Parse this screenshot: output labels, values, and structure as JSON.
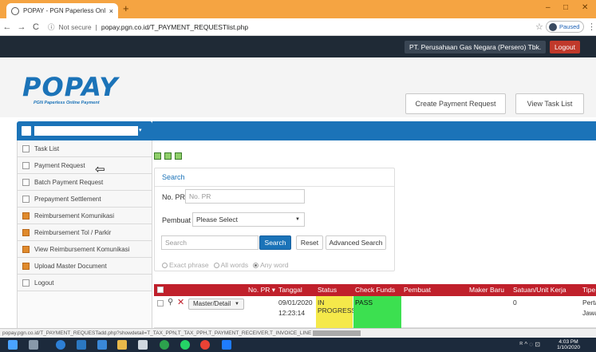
{
  "browser": {
    "tab_title": "POPAY - PGN Paperless Online P...",
    "tab_close": "×",
    "new_tab": "+",
    "win_min": "–",
    "win_max": "□",
    "win_close": "✕",
    "back": "←",
    "forward": "→",
    "reload": "C",
    "security_label": "Not secure",
    "url": "popay.pgn.co.id/T_PAYMENT_REQUESTlist.php",
    "star": "☆",
    "profile_label": "Paused",
    "menu": "⋮"
  },
  "topbar": {
    "company": "PT. Perusahaan Gas Negara (Persero) Tbk.",
    "logout": "Logout"
  },
  "header": {
    "logo_word": "POPAY",
    "logo_sub": "PGN Paperless Online Payment",
    "create_payment_request": "Create Payment Request",
    "view_task_list": "View Task List"
  },
  "sidebar": {
    "caret": "▾",
    "items": [
      {
        "label": "Task List",
        "icon": "doc"
      },
      {
        "label": "Payment Request",
        "icon": "doc"
      },
      {
        "label": "Batch Payment Request",
        "icon": "doc"
      },
      {
        "label": "Prepayment Settlement",
        "icon": "doc"
      },
      {
        "label": "Reimbursement Komunikasi",
        "icon": "org"
      },
      {
        "label": "Reimbursement Tol / Parkir",
        "icon": "org"
      },
      {
        "label": "View Reimbursement Komunikasi",
        "icon": "org"
      },
      {
        "label": "Upload Master Document",
        "icon": "org"
      },
      {
        "label": "Logout",
        "icon": "doc"
      }
    ],
    "pointer": "⇦"
  },
  "search": {
    "title": "Search",
    "no_pr_label": "No. PR",
    "no_pr_placeholder": "No. PR",
    "pembuat_label": "Pembuat",
    "pembuat_value": "Please Select",
    "keyword_placeholder": "Search",
    "search_button": "Search",
    "reset_button": "Reset",
    "advanced_button": "Advanced Search",
    "radios": [
      "Exact phrase",
      "All words",
      "Any word"
    ],
    "radio_selected": "Any word"
  },
  "table": {
    "headers": [
      "No. PR ▾",
      "Tanggal",
      "Status",
      "Check Funds",
      "Pembuat",
      "Maker Baru",
      "Satuan/Unit Kerja",
      "Tipe P"
    ],
    "row": {
      "action": "Master/Detail",
      "tanggal_date": "09/01/2020",
      "tanggal_time": "12:23:14",
      "status_line1": "IN",
      "status_line2": "PROGRESS",
      "check_funds": "PASS",
      "satuan": "0",
      "tipe_line1": "Pertan",
      "tipe_line2": "Jawab"
    }
  },
  "statusbar": {
    "url": "popay.pgn.co.id/T_PAYMENT_REQUESTadd.php?showdetail=T_TAX_PPN,T_TAX_PPH,T_PAYMENT_RECEIVER,T_INVOICE_LINE"
  },
  "taskbar": {
    "time": "4:03 PM",
    "date": "1/10/2020",
    "tray": "ᴿ ^ ◌ ⊡"
  }
}
